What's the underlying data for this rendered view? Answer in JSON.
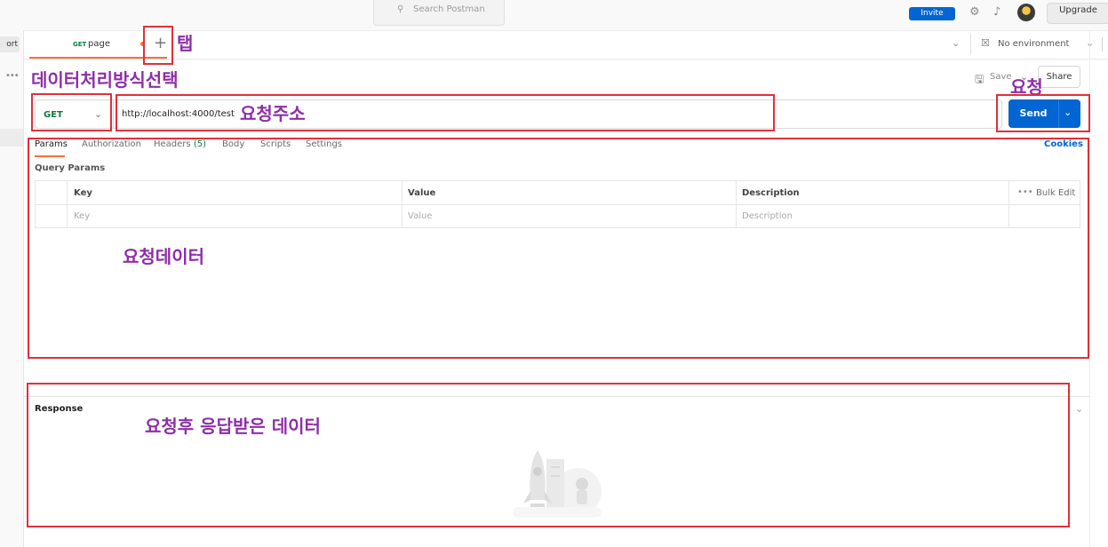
{
  "topbar": {
    "search_placeholder": "Search Postman",
    "invite_label": "Invite",
    "upgrade_label": "Upgrade"
  },
  "sidebar": {
    "import_label": "ort",
    "more_icon": "more-dots-icon"
  },
  "tabs": [
    {
      "method": "GET",
      "name": "page",
      "unsaved": true,
      "accent": "#ff6c37"
    }
  ],
  "environment": {
    "label": "No environment"
  },
  "request_actions": {
    "save_label": "Save",
    "share_label": "Share"
  },
  "request": {
    "method": "GET",
    "method_color": "#0c7a3e",
    "url": "http://localhost:4000/test",
    "send_label": "Send",
    "send_color": "#0265d2"
  },
  "request_tabs": [
    {
      "label": "Params",
      "active": true
    },
    {
      "label": "Authorization"
    },
    {
      "label": "Headers",
      "count": "(5)"
    },
    {
      "label": "Body"
    },
    {
      "label": "Scripts"
    },
    {
      "label": "Settings"
    }
  ],
  "cookies_label": "Cookies",
  "query_params": {
    "title": "Query Params",
    "headers": [
      "Key",
      "Value",
      "Description"
    ],
    "placeholders": [
      "Key",
      "Value",
      "Description"
    ],
    "bulk_edit_label": "Bulk Edit"
  },
  "response": {
    "title": "Response"
  },
  "annotations": {
    "tab": "탭",
    "method": "데이터처리방식선택",
    "url": "요청주소",
    "send": "요청",
    "params": "요청데이터",
    "response": "요청후 응답받은 데이터",
    "color": "#e0303a",
    "text_color": "#8e2fa8"
  }
}
